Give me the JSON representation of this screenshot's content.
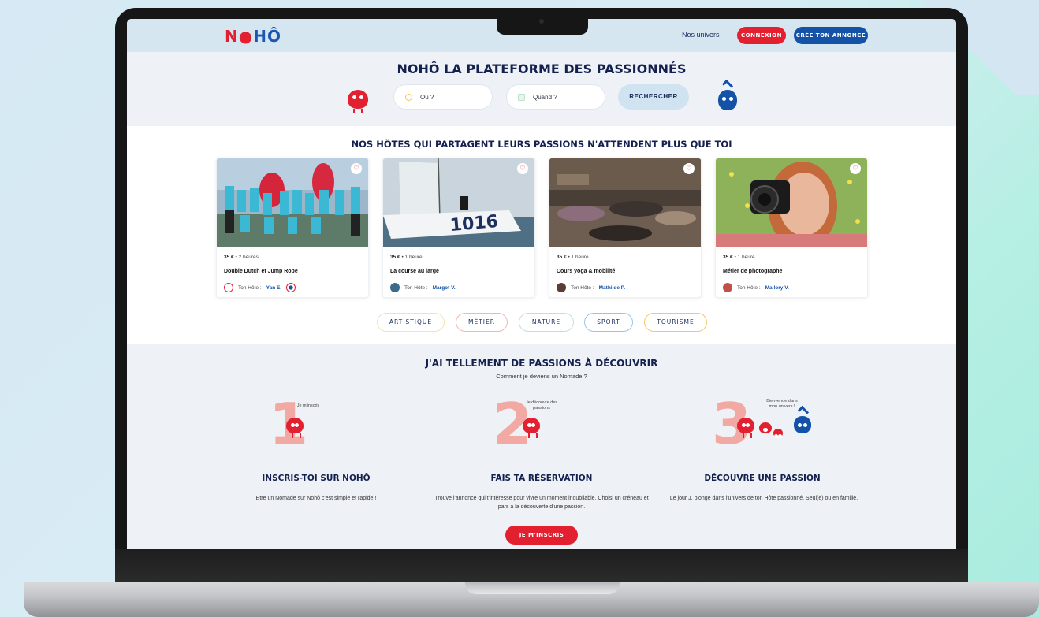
{
  "header": {
    "logo": {
      "n": "N",
      "o": "●",
      "h": "H",
      "hat_o": "Ô"
    },
    "nav_link": "Nos univers",
    "login_label": "CONNEXION",
    "create_ad_label": "CRÉE TON ANNONCE"
  },
  "hero": {
    "title": "NOHÔ LA PLATEFORME DES PASSIONNÉS",
    "where_placeholder": "Où ?",
    "when_placeholder": "Quand ?",
    "search_label": "RECHERCHER"
  },
  "hosts_section": {
    "title": "NOS HÔTES QUI PARTAGENT LEURS PASSIONS N'ATTENDENT PLUS QUE TOI",
    "host_prefix": "Ton Hôte :",
    "cards": [
      {
        "price": "35 €",
        "duration": "2 heures",
        "title": "Double Dutch et Jump Rope",
        "host": "Yan E."
      },
      {
        "price": "35 €",
        "duration": "1 heure",
        "title": "La course au large",
        "host": "Margot V.",
        "boat_number": "1016"
      },
      {
        "price": "35 €",
        "duration": "1 heure",
        "title": "Cours yoga & mobilité",
        "host": "Mathilde P."
      },
      {
        "price": "35 €",
        "duration": "1 heure",
        "title": "Métier de photographe",
        "host": "Mallory V."
      }
    ],
    "categories": [
      "ARTISTIQUE",
      "MÉTIER",
      "NATURE",
      "SPORT",
      "TOURISME"
    ]
  },
  "steps_section": {
    "title": "J'AI TELLEMENT DE PASSIONS À DÉCOUVRIR",
    "subtitle": "Comment je deviens un Nomade ?",
    "steps": [
      {
        "number": "1",
        "bubble": "Je m'inscris",
        "title": "INSCRIS-TOI SUR NOHÔ",
        "text": "Etre un Nomade sur Nohô c'est simple et rapide !"
      },
      {
        "number": "2",
        "bubble": "Je découvre des passions",
        "title": "FAIS TA RÉSERVATION",
        "text": "Trouve l'annonce qui t'intéresse pour vivre un moment inoubliable. Choisi un créneau et pars à la découverte d'une passion."
      },
      {
        "number": "3",
        "bubble": "Bienvenue dans mon univers !",
        "title": "DÉCOUVRE UNE PASSION",
        "text": "Le jour J, plonge dans l'univers de ton Hôte passionné. Seul(e) ou en famille."
      }
    ],
    "cta_label": "JE M'INSCRIS"
  },
  "colors": {
    "brand_red": "#e3202f",
    "brand_blue": "#1452a8",
    "navy_text": "#14214f",
    "step_number_pink": "#f2a9a3"
  }
}
